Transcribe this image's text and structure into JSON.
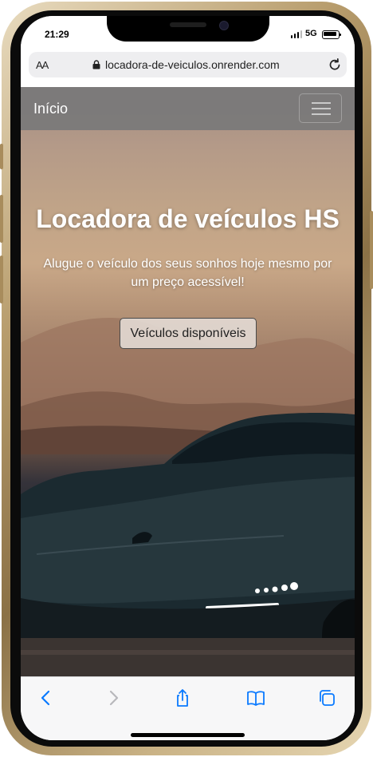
{
  "status_bar": {
    "time": "21:29",
    "network": "5G"
  },
  "browser": {
    "text_size_label": "AA",
    "url": "locadora-de-veiculos.onrender.com",
    "icons": [
      "lock-icon",
      "reload-icon",
      "back-icon",
      "forward-icon",
      "share-icon",
      "bookmarks-icon",
      "tabs-icon"
    ]
  },
  "navbar": {
    "brand": "Início",
    "menu_icon": "hamburger-menu-icon"
  },
  "hero": {
    "title": "Locadora de veículos HS",
    "subtitle": "Alugue o veículo dos seus sonhos hoje mesmo por um preço acessível!",
    "button_label": "Veículos disponíveis"
  },
  "colors": {
    "navbar_background": "#78787a",
    "browser_accent": "#0a7aff",
    "hero_text": "#ffffff",
    "button_background": "#e4dcd6"
  }
}
